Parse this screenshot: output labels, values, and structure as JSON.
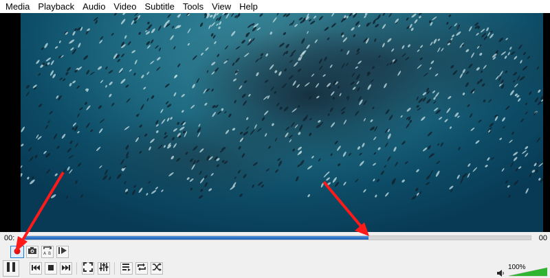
{
  "menu": {
    "items": [
      "Media",
      "Playback",
      "Audio",
      "Video",
      "Subtitle",
      "Tools",
      "View",
      "Help"
    ]
  },
  "seek": {
    "elapsed": "00:",
    "total": "00",
    "progress": 0.68
  },
  "volume": {
    "label": "100%",
    "level": 1.0
  },
  "icons": {
    "record": "record-icon",
    "snapshot": "camera-icon",
    "loop_ab": "loop-ab-icon",
    "frame_step": "frame-step-icon",
    "pause": "pause-icon",
    "previous": "previous-icon",
    "stop": "stop-icon",
    "next": "next-icon",
    "fullscreen": "fullscreen-icon",
    "extended": "extended-settings-icon",
    "playlist": "playlist-icon",
    "loop": "loop-icon",
    "shuffle": "shuffle-icon",
    "speaker": "speaker-icon"
  },
  "colors": {
    "seek_fill": "#1a5fb4",
    "record_dot": "#e01010",
    "annotation_arrow": "#ff1a1a",
    "volume_fill": "#2fb52f"
  }
}
